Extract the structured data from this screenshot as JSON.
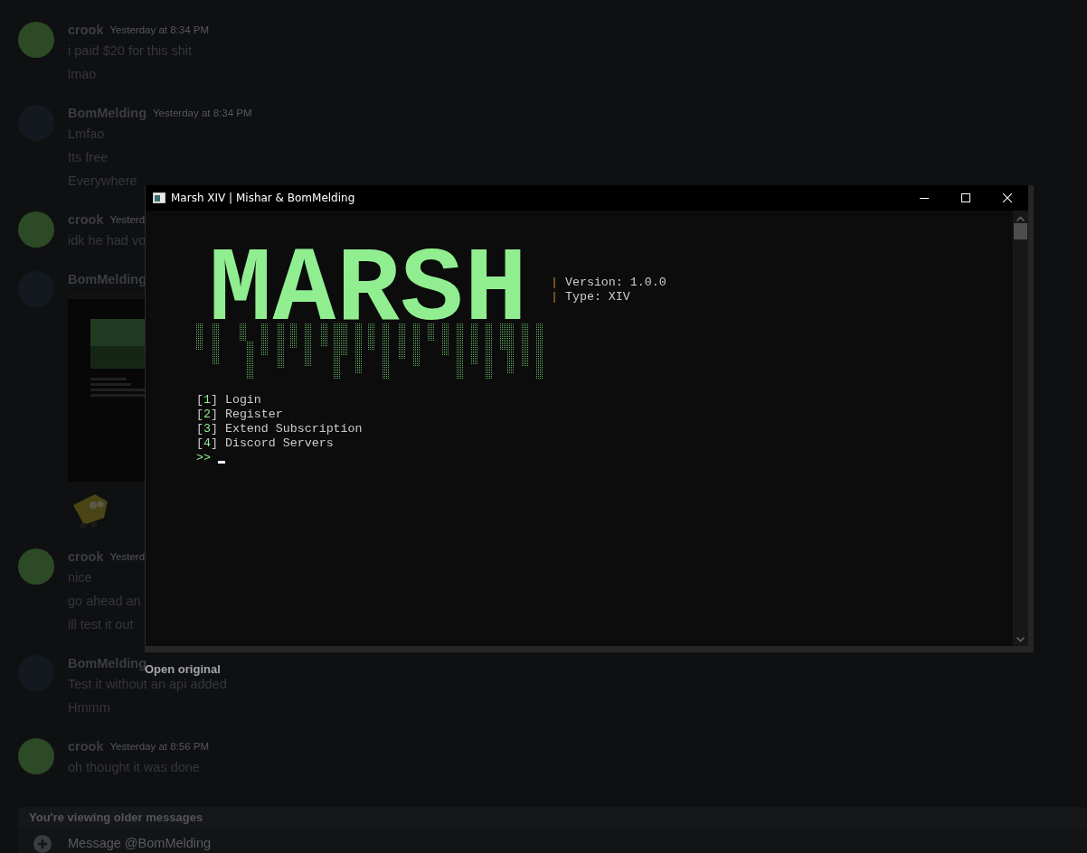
{
  "chat": {
    "messages": [
      {
        "author": "crook",
        "color": "#2c4a26",
        "timestamp": "Yesterday at 8:34 PM",
        "lines": [
          "i paid $20 for this shit",
          "lmao"
        ]
      },
      {
        "author": "BomMelding",
        "color": "#14191f",
        "timestamp": "Yesterday at 8:34 PM",
        "lines": [
          "Lmfao",
          "Its free",
          "Everywhere"
        ]
      },
      {
        "author": "crook",
        "color": "#2c4a26",
        "timestamp": "Yesterd",
        "lines": [
          "idk he had vo"
        ]
      },
      {
        "author": "BomMelding",
        "color": "#14191f",
        "attachments": [
          {
            "kind": "screenshot"
          },
          {
            "kind": "sticker"
          }
        ]
      },
      {
        "author": "crook",
        "color": "#2c4a26",
        "timestamp": "Yesterd",
        "lines": [
          "nice",
          "go ahead an",
          "ill test it out"
        ]
      },
      {
        "author": "BomMelding",
        "color": "#14191f",
        "lines": [
          "Test it without an api added",
          "Hmmm"
        ]
      },
      {
        "author": "crook",
        "color": "#2c4a26",
        "timestamp": "Yesterday at 8:56 PM",
        "lines": [
          "oh thought it was done"
        ]
      }
    ]
  },
  "console": {
    "title": "Marsh XIV | Mishar & BomMelding",
    "logo": "MARSH",
    "info": [
      {
        "pipe": "|",
        "text": "Version: 1.0.0"
      },
      {
        "pipe": "|",
        "text": "Type: XIV"
      }
    ],
    "menu": [
      {
        "open": "[",
        "number": "1",
        "close": "]",
        "label": "Login"
      },
      {
        "open": "[",
        "number": "2",
        "close": "]",
        "label": "Register"
      },
      {
        "open": "[",
        "number": "3",
        "close": "]",
        "label": "Extend Subscription"
      },
      {
        "open": "[",
        "number": "4",
        "close": "]",
        "label": "Discord Servers"
      }
    ],
    "prompt": ">>"
  },
  "open_original": "Open original",
  "footer": {
    "notice": "You're viewing older messages",
    "placeholder": "Message @BomMelding"
  }
}
